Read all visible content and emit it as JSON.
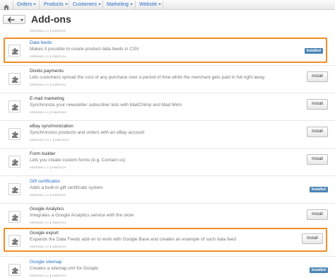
{
  "nav": {
    "home_icon": "home-icon",
    "items": [
      {
        "label": "Orders"
      },
      {
        "label": "Products"
      },
      {
        "label": "Customers"
      },
      {
        "label": "Marketing"
      },
      {
        "label": "Website"
      }
    ]
  },
  "header": {
    "title": "Add-ons",
    "back_icon": "arrow-left-icon",
    "dropdown_icon": "caret-down-icon"
  },
  "previous_item_meta": {
    "version": "VERSION 1.0",
    "developer": "SIMTECH"
  },
  "addons": [
    {
      "name": "Data feeds",
      "description": "Makes it possible to create product data feeds in CSV",
      "version": "VERSION 1.0",
      "developer": "SIMTECH",
      "status": "Installed",
      "installed": true
    },
    {
      "name": "Divido payments",
      "description": "Lets customers spread the cost of any purchase over a period of time while the merchant gets paid in full right away.",
      "version": "VERSION 1.0",
      "developer": "SIMTECH",
      "status": "Install",
      "installed": false
    },
    {
      "name": "E-mail marketing",
      "description": "Synchronize your newsletter subscriber lists with MailChimp and Mad Mimi",
      "version": "VERSION 1.0",
      "developer": "SIMTECH",
      "status": "Install",
      "installed": false
    },
    {
      "name": "eBay synchronization",
      "description": "Synchronizes products and orders with an eBay account",
      "version": "VERSION 2.0.1",
      "developer": "SIMTECH",
      "status": "Install",
      "installed": false
    },
    {
      "name": "Form builder",
      "description": "Lets you create custom forms (e.g. Contact us)",
      "version": "VERSION 1.0",
      "developer": "SIMTECH",
      "status": "Install",
      "installed": false
    },
    {
      "name": "Gift certificates",
      "description": "Adds a built-in gift certificate system",
      "version": "VERSION 1.0",
      "developer": "SIMTECH",
      "status": "Installed",
      "installed": true
    },
    {
      "name": "Google Analytics",
      "description": "Integrates a Google Analytics service with the store",
      "version": "VERSION 1.0",
      "developer": "SIMTECH",
      "status": "Install",
      "installed": false
    },
    {
      "name": "Google export",
      "description": "Expands the Data Feeds add-on to work with Google Base and creates an example of such data feed",
      "version": "VERSION 1.0",
      "developer": "SIMTECH",
      "status": "Install",
      "installed": false
    },
    {
      "name": "Google sitemap",
      "description": "Creates a sitemap.xml for Google",
      "version": "VERSION 1.0",
      "developer": "SIMTECH",
      "status": "Installed",
      "installed": true
    }
  ],
  "highlight_color": "#f28c28",
  "link_color": "#2a6ec5",
  "installed_badge_color": "#4a84b4",
  "addon_icon": "puzzle-piece-icon"
}
